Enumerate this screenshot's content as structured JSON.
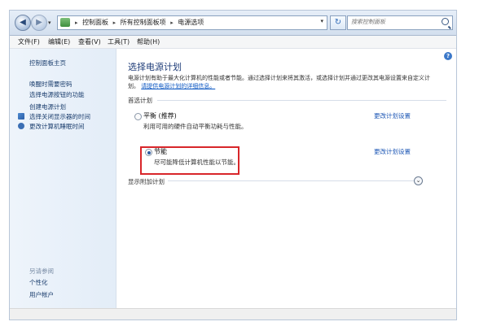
{
  "address_bar": {
    "crumbs": [
      "控制面板",
      "所有控制面板项",
      "电源选项"
    ],
    "search_placeholder": "搜索控制面板"
  },
  "menu": [
    "文件(F)",
    "编辑(E)",
    "查看(V)",
    "工具(T)",
    "帮助(H)"
  ],
  "sidebar": {
    "home": "控制面板主页",
    "links": [
      "唤醒时需要密码",
      "选择电源按钮的功能",
      "创建电源计划",
      "选择关闭显示器的时间",
      "更改计算机睡眠时间"
    ],
    "see_also_title": "另请参阅",
    "see_also": [
      "个性化",
      "用户帐户"
    ]
  },
  "main": {
    "title": "选择电源计划",
    "description": "电源计划有助于最大化计算机的性能或者节能。通过选择计划来将其激活，或选择计划并通过更改其电源设置来自定义计划。",
    "description_link": "请提供电源计划的详细信息。",
    "group_label": "首选计划",
    "plans": [
      {
        "name": "平衡 (推荐)",
        "desc": "利用可用的硬件自动平衡功耗与性能。",
        "link": "更改计划设置",
        "selected": false
      },
      {
        "name": "节能",
        "desc": "尽可能降低计算机性能以节能。",
        "link": "更改计划设置",
        "selected": true
      }
    ],
    "extra_plans_label": "显示附加计划"
  },
  "colors": {
    "highlight_border": "#d8262a",
    "link": "#1d57b5",
    "title": "#1e3c78"
  }
}
